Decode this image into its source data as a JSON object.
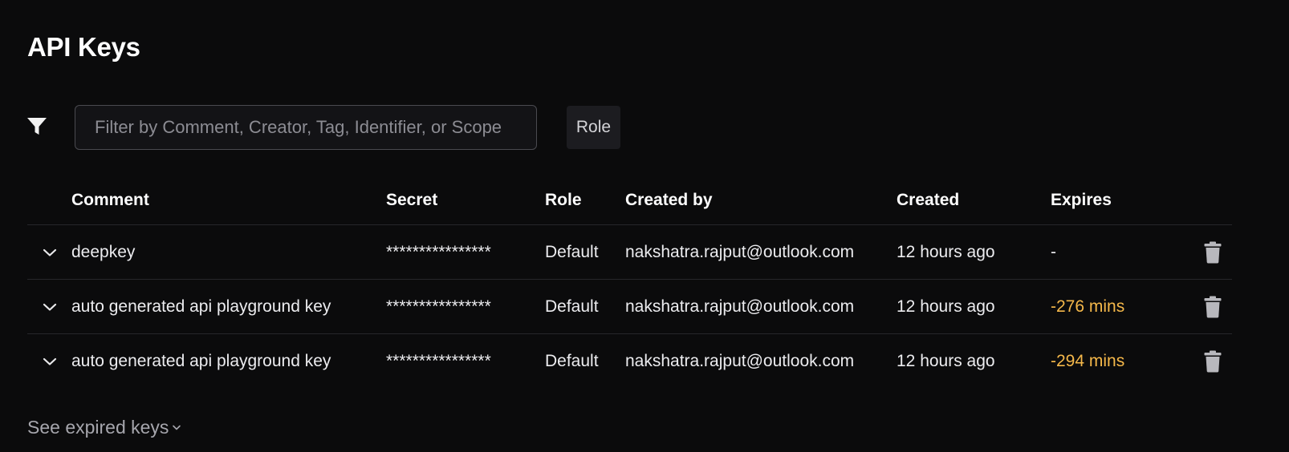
{
  "page": {
    "title": "API Keys"
  },
  "filter": {
    "icon": "filter-icon",
    "placeholder": "Filter by Comment, Creator, Tag, Identifier, or Scope",
    "value": "",
    "role_button_label": "Role"
  },
  "table": {
    "columns": {
      "comment": "Comment",
      "secret": "Secret",
      "role": "Role",
      "created_by": "Created by",
      "created": "Created",
      "expires": "Expires"
    },
    "rows": [
      {
        "comment": "deepkey",
        "secret": "****************",
        "role": "Default",
        "created_by": "nakshatra.rajput@outlook.com",
        "created": "12 hours ago",
        "expires": "-",
        "expired": false
      },
      {
        "comment": "auto generated api playground key",
        "secret": "****************",
        "role": "Default",
        "created_by": "nakshatra.rajput@outlook.com",
        "created": "12 hours ago",
        "expires": "-276 mins",
        "expired": true
      },
      {
        "comment": "auto generated api playground key",
        "secret": "****************",
        "role": "Default",
        "created_by": "nakshatra.rajput@outlook.com",
        "created": "12 hours ago",
        "expires": "-294 mins",
        "expired": true
      }
    ]
  },
  "footer": {
    "see_expired_label": "See expired keys"
  },
  "colors": {
    "background": "#0b0b0c",
    "expired_text": "#f5b84a",
    "row_divider": "#26262a"
  }
}
